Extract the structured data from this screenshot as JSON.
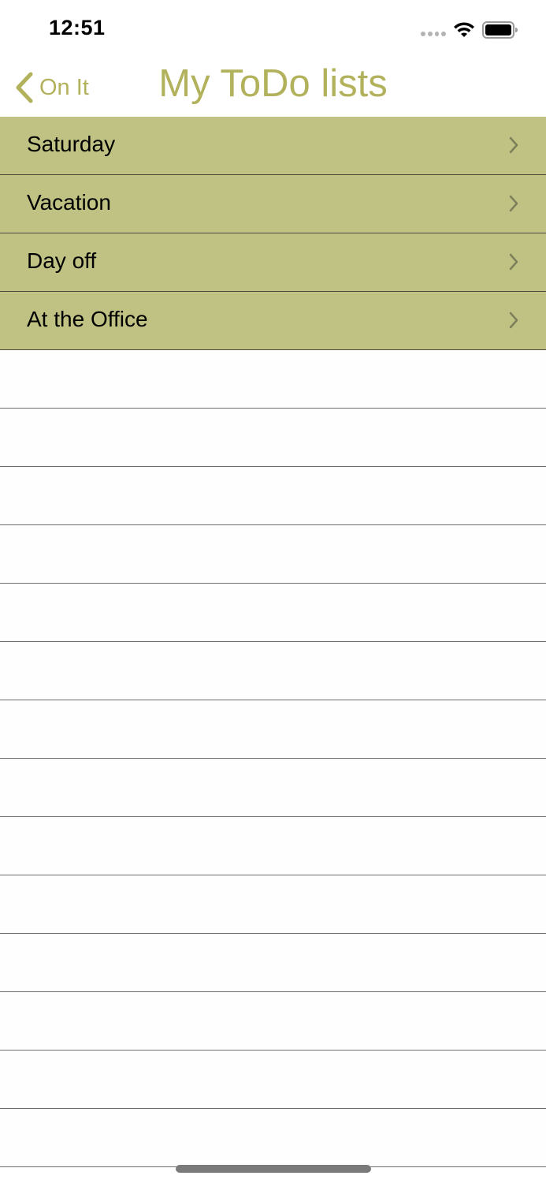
{
  "status_bar": {
    "time": "12:51",
    "icons": [
      "signal-dots-icon",
      "wifi-icon",
      "battery-icon"
    ]
  },
  "nav": {
    "back_label": "On It",
    "back_icon": "chevron-left-icon",
    "title": "My ToDo lists"
  },
  "colors": {
    "accent": "#b3b25c",
    "row_background": "#bfc282",
    "separator": "#4a4a3c"
  },
  "lists": [
    {
      "label": "Saturday"
    },
    {
      "label": "Vacation"
    },
    {
      "label": "Day off"
    },
    {
      "label": "At the Office"
    }
  ],
  "row_icon": "chevron-right-icon"
}
